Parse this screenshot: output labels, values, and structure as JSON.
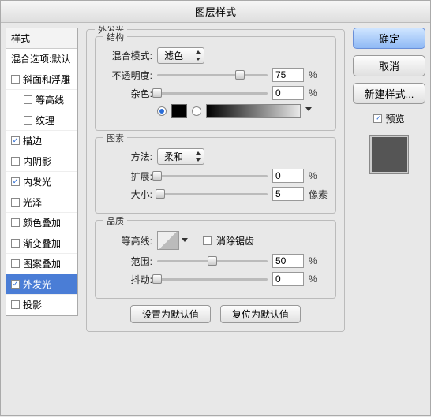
{
  "title": "图层样式",
  "sidebar": {
    "header": "样式",
    "blend_options": "混合选项:默认",
    "items": [
      {
        "label": "斜面和浮雕",
        "checked": false
      },
      {
        "label": "等高线",
        "checked": false,
        "indent": true
      },
      {
        "label": "纹理",
        "checked": false,
        "indent": true
      },
      {
        "label": "描边",
        "checked": true
      },
      {
        "label": "内阴影",
        "checked": false
      },
      {
        "label": "内发光",
        "checked": true
      },
      {
        "label": "光泽",
        "checked": false
      },
      {
        "label": "颜色叠加",
        "checked": false
      },
      {
        "label": "渐变叠加",
        "checked": false
      },
      {
        "label": "图案叠加",
        "checked": false
      },
      {
        "label": "外发光",
        "checked": true,
        "selected": true
      },
      {
        "label": "投影",
        "checked": false
      }
    ]
  },
  "panel": {
    "title": "外发光",
    "structure": {
      "legend": "结构",
      "blend_mode_label": "混合模式:",
      "blend_mode_value": "滤色",
      "opacity_label": "不透明度:",
      "opacity_value": "75",
      "opacity_unit": "%",
      "noise_label": "杂色:",
      "noise_value": "0",
      "noise_unit": "%"
    },
    "elements": {
      "legend": "图素",
      "technique_label": "方法:",
      "technique_value": "柔和",
      "spread_label": "扩展:",
      "spread_value": "0",
      "spread_unit": "%",
      "size_label": "大小:",
      "size_value": "5",
      "size_unit": "像素"
    },
    "quality": {
      "legend": "品质",
      "contour_label": "等高线:",
      "anti_alias_label": "消除锯齿",
      "range_label": "范围:",
      "range_value": "50",
      "range_unit": "%",
      "jitter_label": "抖动:",
      "jitter_value": "0",
      "jitter_unit": "%"
    },
    "buttons": {
      "make_default": "设置为默认值",
      "reset_default": "复位为默认值"
    }
  },
  "right": {
    "ok": "确定",
    "cancel": "取消",
    "new_style": "新建样式...",
    "preview_label": "预览"
  }
}
